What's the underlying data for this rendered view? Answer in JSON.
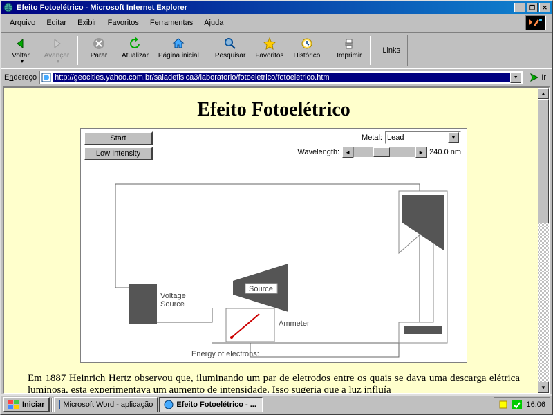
{
  "window": {
    "title": "Efeito Fotoelétrico - Microsoft Internet Explorer"
  },
  "menu": {
    "arquivo": "Arquivo",
    "editar": "Editar",
    "exibir": "Exibir",
    "favoritos": "Favoritos",
    "ferramentas": "Ferramentas",
    "ajuda": "Ajuda"
  },
  "toolbar": {
    "voltar": "Voltar",
    "avancar": "Avançar",
    "parar": "Parar",
    "atualizar": "Atualizar",
    "pagina_inicial": "Página inicial",
    "pesquisar": "Pesquisar",
    "favoritos": "Favoritos",
    "historico": "Histórico",
    "imprimir": "Imprimir",
    "links": "Links"
  },
  "address": {
    "label": "Endereço",
    "url": "http://geocities.yahoo.com.br/saladefisica3/laboratorio/fotoeletrico/fotoeletrico.htm",
    "go": "Ir"
  },
  "page": {
    "title": "Efeito Fotoelétrico",
    "start_btn": "Start",
    "intensity_btn": "Low Intensity",
    "metal_label": "Metal:",
    "metal_value": "Lead",
    "wavelength_label": "Wavelength:",
    "wavelength_value": "240.0 nm",
    "voltage_source": "Voltage\nSource",
    "source": "Source",
    "ammeter": "Ammeter",
    "energy_label": "Energy of electrons:",
    "body_text": "Em 1887 Heinrich Hertz observou que, iluminando um par de eletrodos entre os quais se dava uma descarga elétrica luminosa, esta experimentava um aumento de intensidade. Isso sugeria que a luz influía"
  },
  "taskbar": {
    "start": "Iniciar",
    "task1": "Microsoft Word - aplicação",
    "task2": "Efeito Fotoelétrico - ...",
    "clock": "16:06"
  }
}
